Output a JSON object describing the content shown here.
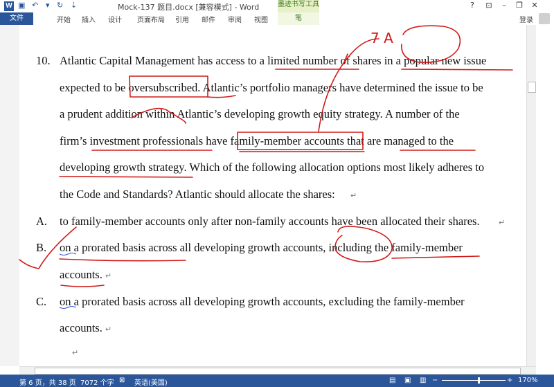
{
  "window": {
    "title": "Mock-137 题目.docx [兼容模式] - Word",
    "tool_tab": "墨迹书写工具",
    "help": "?",
    "login": "登录"
  },
  "ribbon": {
    "file": "文件",
    "tabs": [
      "开始",
      "插入",
      "设计",
      "页面布局",
      "引用",
      "邮件",
      "审阅",
      "视图"
    ],
    "pen": "笔"
  },
  "document": {
    "q_number": "10.",
    "lines": [
      "Atlantic Capital Management has access to a limited number of shares in a popular new issue",
      "expected to be oversubscribed. Atlantic’s portfolio managers have determined the issue to be",
      "a prudent addition within Atlantic’s developing growth equity strategy. A number of the",
      "firm’s investment professionals have family-member accounts that are managed to the",
      "developing growth strategy. Which of the following allocation options most likely adheres to",
      "the Code and Standards? Atlantic should allocate the shares:"
    ],
    "options": [
      {
        "label": "A.",
        "lines": [
          "to family-member accounts only after non-family accounts have been allocated their shares."
        ]
      },
      {
        "label": "B.",
        "lines": [
          "on a prorated basis across all developing growth accounts, including the family-member",
          "accounts."
        ]
      },
      {
        "label": "C.",
        "lines": [
          "on a prorated basis across all developing growth accounts, excluding the family-member",
          "accounts."
        ]
      }
    ],
    "handwriting": "7 A"
  },
  "status": {
    "page": "第 6 页，共 38 页",
    "words": "7072 个字",
    "language": "英语(美国)",
    "zoom_minus": "−",
    "zoom_plus": "+",
    "zoom": "170%"
  },
  "colors": {
    "accent": "#2b579a",
    "ink": "#d11a1a"
  }
}
